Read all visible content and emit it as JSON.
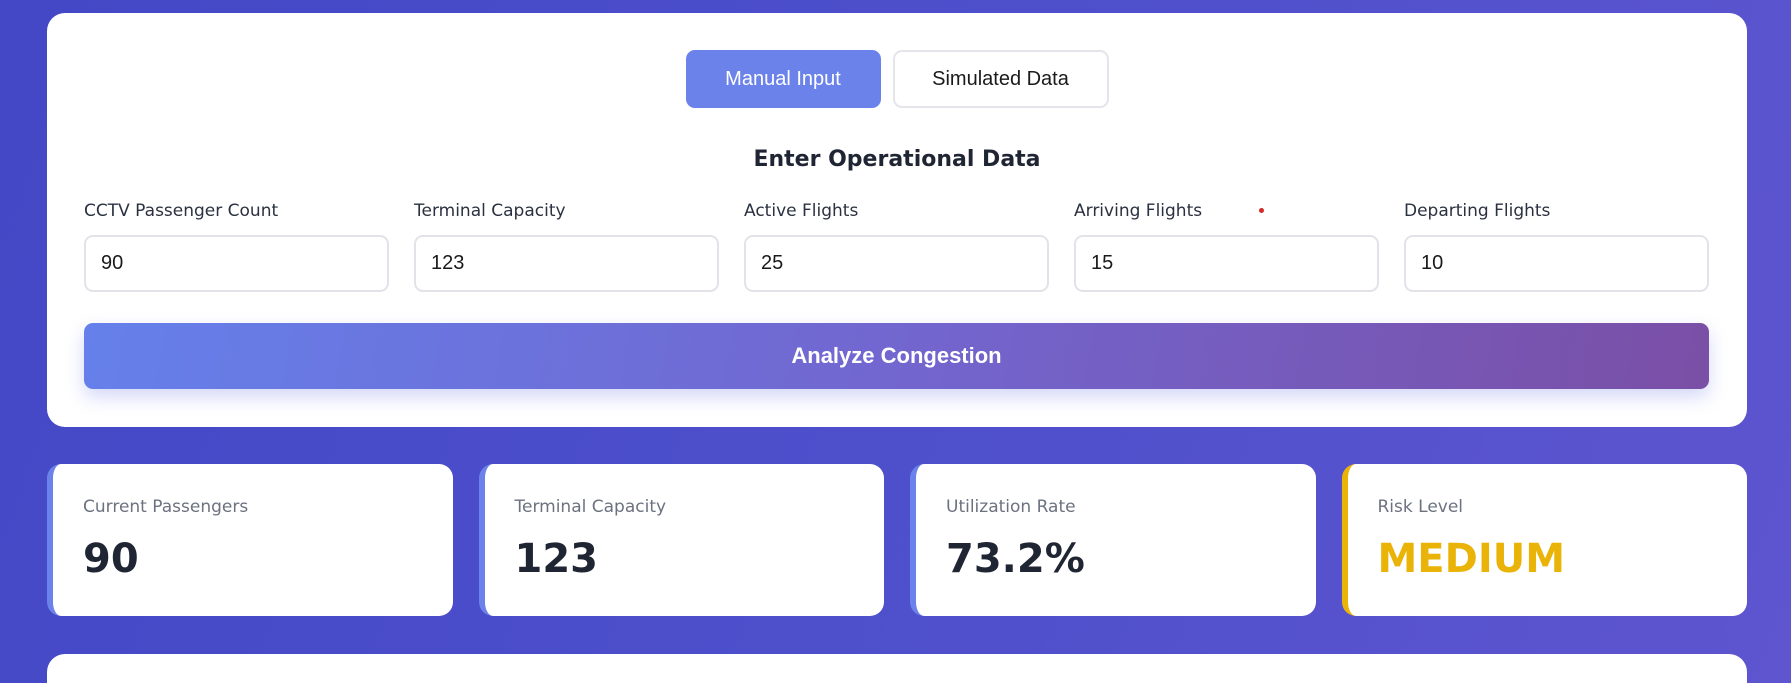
{
  "mode_toggle": {
    "manual_label": "Manual Input",
    "simulated_label": "Simulated Data",
    "active": "manual"
  },
  "form": {
    "title": "Enter Operational Data",
    "fields": [
      {
        "label": "CCTV Passenger Count",
        "value": "90"
      },
      {
        "label": "Terminal Capacity",
        "value": "123"
      },
      {
        "label": "Active Flights",
        "value": "25"
      },
      {
        "label": "Arriving Flights",
        "value": "15"
      },
      {
        "label": "Departing Flights",
        "value": "10"
      }
    ],
    "submit_label": "Analyze Congestion"
  },
  "stats": [
    {
      "label": "Current Passengers",
      "value": "90"
    },
    {
      "label": "Terminal Capacity",
      "value": "123"
    },
    {
      "label": "Utilization Rate",
      "value": "73.2%"
    },
    {
      "label": "Risk Level",
      "value": "MEDIUM"
    }
  ],
  "colors": {
    "accent": "#6b82ea",
    "risk_medium": "#eab308",
    "background": "#4a4dc9"
  }
}
